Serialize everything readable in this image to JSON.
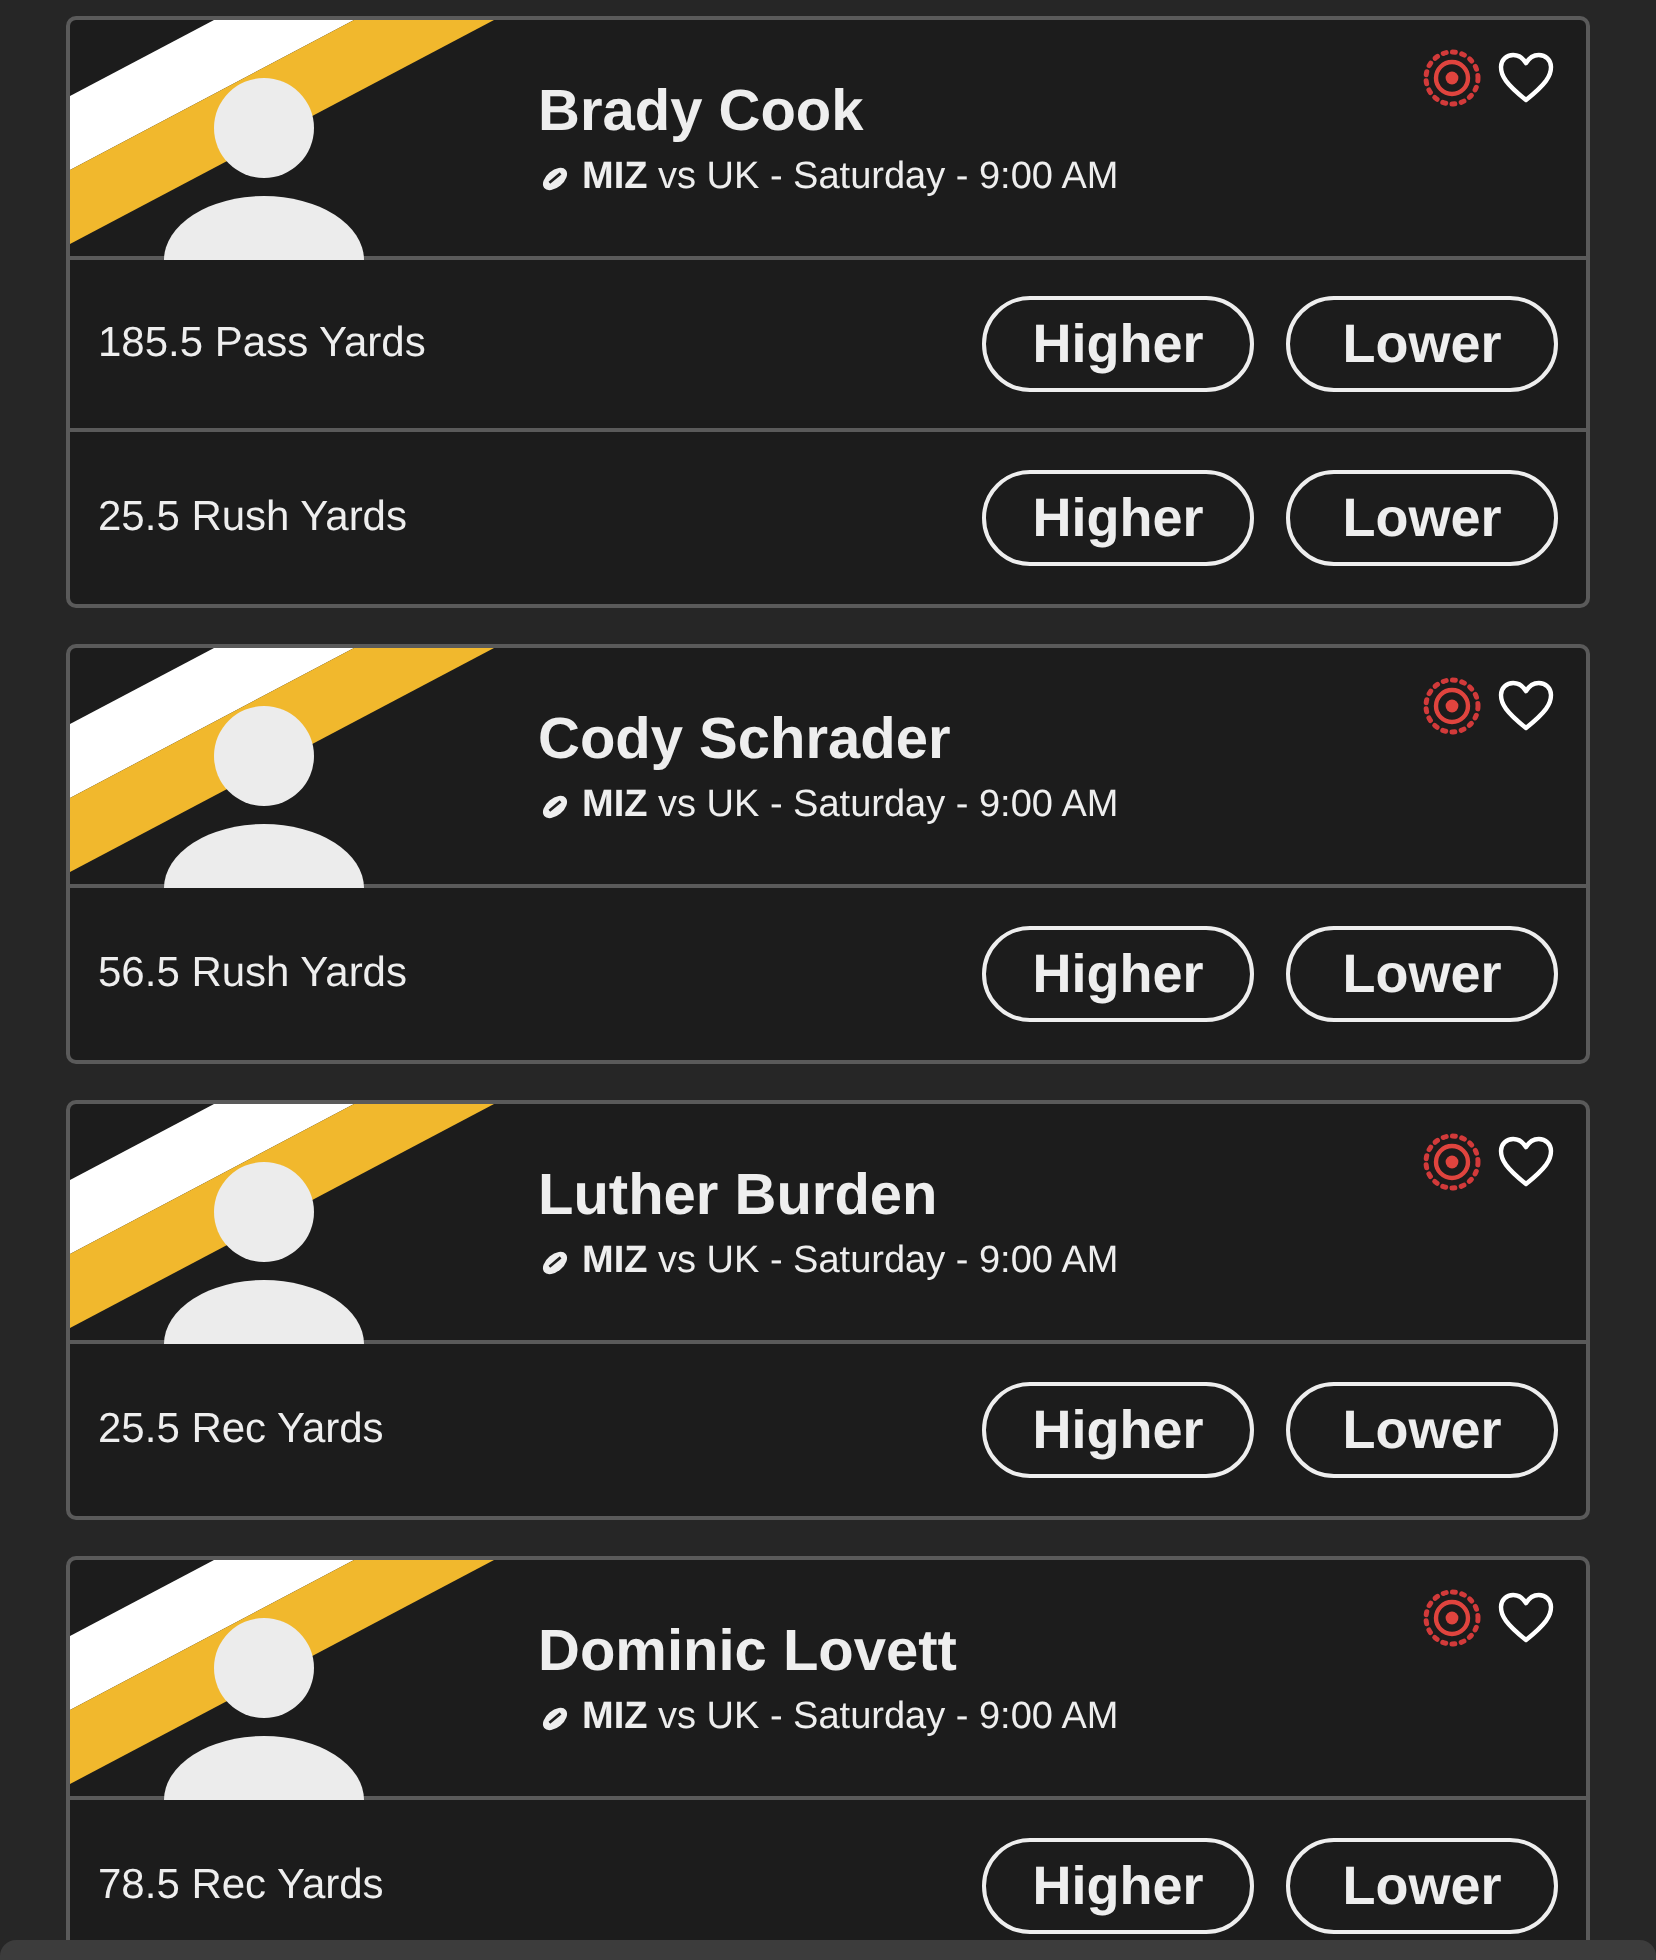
{
  "players": [
    {
      "name": "Brady Cook",
      "matchup": "**MIZ** vs UK - Saturday - 9:00 AM",
      "props": [
        {
          "label": "185.5 Pass Yards",
          "higher": "Higher",
          "lower": "Lower"
        },
        {
          "label": "25.5 Rush Yards",
          "higher": "Higher",
          "lower": "Lower"
        }
      ]
    },
    {
      "name": "Cody Schrader",
      "matchup": "**MIZ** vs UK - Saturday - 9:00 AM",
      "props": [
        {
          "label": "56.5 Rush Yards",
          "higher": "Higher",
          "lower": "Lower"
        }
      ]
    },
    {
      "name": "Luther Burden",
      "matchup": "**MIZ** vs UK - Saturday - 9:00 AM",
      "props": [
        {
          "label": "25.5 Rec Yards",
          "higher": "Higher",
          "lower": "Lower"
        }
      ]
    },
    {
      "name": "Dominic Lovett",
      "matchup": "**MIZ** vs UK - Saturday - 9:00 AM",
      "props": [
        {
          "label": "78.5 Rec Yards",
          "higher": "Higher",
          "lower": "Lower"
        }
      ]
    }
  ]
}
